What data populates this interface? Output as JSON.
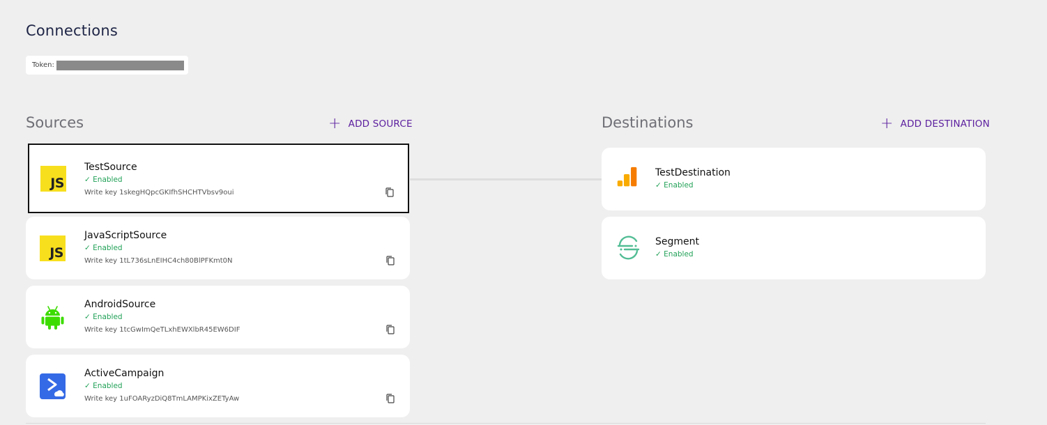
{
  "page": {
    "title": "Connections"
  },
  "token": {
    "label": "Token:"
  },
  "sources": {
    "heading": "Sources",
    "add_label": "ADD SOURCE",
    "items": [
      {
        "name": "TestSource",
        "status": "Enabled",
        "write_key": "Write key 1skegHQpcGKIfhSHCHTVbsv9oui",
        "icon": "javascript-icon"
      },
      {
        "name": "JavaScriptSource",
        "status": "Enabled",
        "write_key": "Write key 1tL736sLnEIHC4ch80BlPFKmt0N",
        "icon": "javascript-icon"
      },
      {
        "name": "AndroidSource",
        "status": "Enabled",
        "write_key": "Write key 1tcGwImQeTLxhEWXlbR45EW6DIF",
        "icon": "android-icon"
      },
      {
        "name": "ActiveCampaign",
        "status": "Enabled",
        "write_key": "Write key 1uFOARyzDiQ8TmLAMPKixZETyAw",
        "icon": "activecampaign-icon"
      }
    ]
  },
  "destinations": {
    "heading": "Destinations",
    "add_label": "ADD DESTINATION",
    "items": [
      {
        "name": "TestDestination",
        "status": "Enabled",
        "icon": "google-analytics-icon"
      },
      {
        "name": "Segment",
        "status": "Enabled",
        "icon": "segment-icon"
      }
    ]
  },
  "colors": {
    "accent": "#5b1e9e",
    "enabled": "#21a157",
    "background": "#efefef",
    "js_yellow": "#f7df1e",
    "android_green": "#3ddc00",
    "activecampaign_blue": "#356ae6",
    "segment_green": "#52bd95"
  },
  "js_logo_text": "JS",
  "check_mark": "✓",
  "plus_glyph": "+"
}
